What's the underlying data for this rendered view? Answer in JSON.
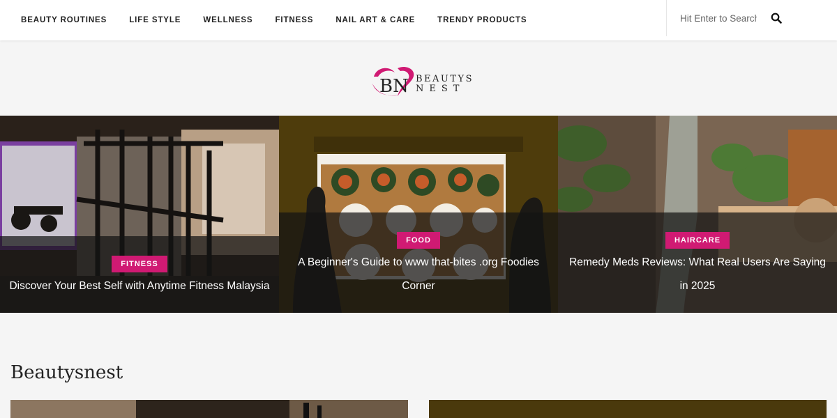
{
  "nav": {
    "items": [
      "BEAUTY ROUTINES",
      "LIFE STYLE",
      "WELLNESS",
      "FITNESS",
      "NAIL ART & CARE",
      "TRENDY PRODUCTS"
    ]
  },
  "search": {
    "placeholder": "Hit Enter to Search",
    "icon": "search-icon"
  },
  "logo": {
    "line1": "BEAUTYS",
    "line2": "NEST",
    "brand_color": "#d01a73"
  },
  "featured": [
    {
      "category": "FITNESS",
      "title": "Discover Your Best Self with Anytime Fitness Malaysia"
    },
    {
      "category": "FOOD",
      "title": "A Beginner's Guide to www that-bites .org Foodies Corner"
    },
    {
      "category": "HAIRCARE",
      "title": "Remedy Meds Reviews: What Real Users Are Saying in 2025"
    }
  ],
  "section": {
    "title": "Beautysnest"
  },
  "colors": {
    "accent": "#d01a73",
    "nav_bg": "#ffffff",
    "page_bg": "#f5f5f5"
  }
}
